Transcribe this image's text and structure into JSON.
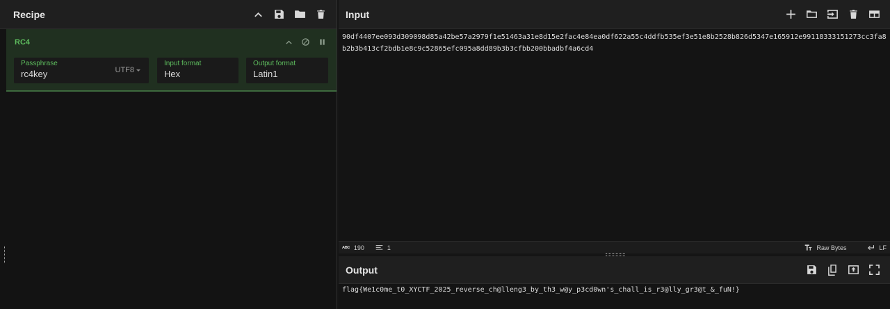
{
  "recipe": {
    "title": "Recipe",
    "icons": [
      "chevron-up-icon",
      "save-icon",
      "folder-icon",
      "trash-icon"
    ]
  },
  "operation": {
    "name": "RC4",
    "passphrase": {
      "label": "Passphrase",
      "value": "rc4key",
      "encoding": "UTF8"
    },
    "input_format": {
      "label": "Input format",
      "value": "Hex"
    },
    "output_format": {
      "label": "Output format",
      "value": "Latin1"
    }
  },
  "input": {
    "title": "Input",
    "text": "90df4407ee093d309098d85a42be57a2979f1e51463a31e8d15e2fac4e84ea0df622a55c4ddfb535ef3e51e8b2528b826d5347e165912e99118333151273cc3fa8b2b3b413cf2bdb1e8c9c52865efc095a8dd89b3b3cfbb200bbadbf4a6cd4",
    "status": {
      "chars": "190",
      "lines": "1",
      "raw_bytes": "Raw Bytes",
      "eol": "LF"
    }
  },
  "output": {
    "title": "Output",
    "text": "flag{We1c0me_t0_XYCTF_2025_reverse_ch@lleng3_by_th3_w@y_p3cd0wn's_chall_is_r3@lly_gr3@t_&_fuN!}"
  }
}
